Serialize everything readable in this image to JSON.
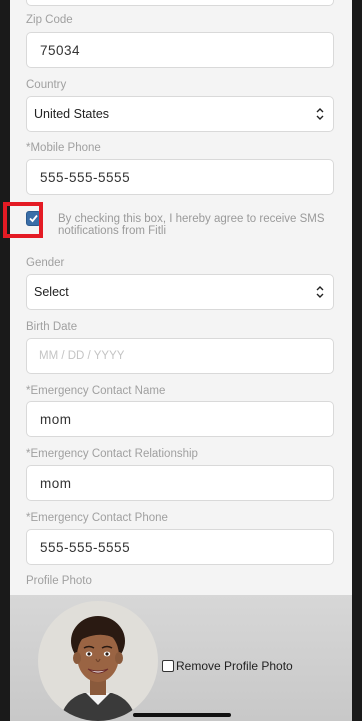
{
  "form": {
    "zip": {
      "label": "Zip Code",
      "value": "75034"
    },
    "country": {
      "label": "Country",
      "value": "United States"
    },
    "mobile": {
      "label": "*Mobile Phone",
      "value": "555-555-5555"
    },
    "sms_consent": {
      "checked": true,
      "text": "By checking this box, I hereby agree to receive SMS notifications from Fitli"
    },
    "gender": {
      "label": "Gender",
      "value": "Select"
    },
    "birth_date": {
      "label": "Birth Date",
      "placeholder": "MM / DD / YYYY"
    },
    "emergency_name": {
      "label": "*Emergency Contact Name",
      "value": "mom"
    },
    "emergency_relationship": {
      "label": "*Emergency Contact Relationship",
      "value": "mom"
    },
    "emergency_phone": {
      "label": "*Emergency Contact Phone",
      "value": "555-555-5555"
    },
    "profile_photo": {
      "label": "Profile Photo",
      "remove_label": "Remove Profile Photo"
    }
  },
  "colors": {
    "highlight": "#e41b24",
    "checkbox": "#3a6ea8"
  }
}
